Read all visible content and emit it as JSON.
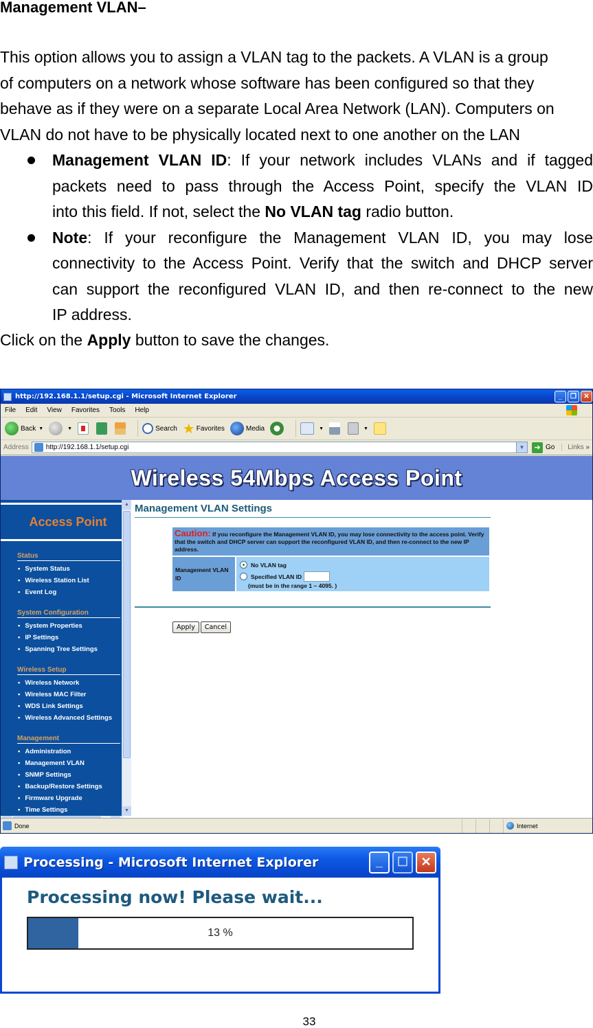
{
  "doc": {
    "heading": "Management VLAN–",
    "intro_lines": [
      "This option allows you to assign a VLAN tag to the packets. A VLAN is a group",
      "of computers on a network whose software has been configured so that they",
      "behave as if they were on a separate Local Area Network (LAN). Computers on",
      "VLAN do not have to be physically located next to one another on the LAN"
    ],
    "bullets": [
      {
        "term": "Management VLAN ID",
        "lines": [
          ": If your network includes VLANs and if tagged",
          "packets need to pass through the Access Point, specify the VLAN ID",
          "into this field. If not, select the "
        ],
        "bold_inline": "No VLAN tag",
        "tail": " radio button."
      },
      {
        "term": "Note",
        "lines": [
          ": If your reconfigure the Management VLAN ID, you may lose",
          "connectivity to the Access Point. Verify that the switch and DHCP server",
          "can support the reconfigured VLAN ID, and then re-connect to the new",
          "IP address."
        ]
      }
    ],
    "click_prefix": "Click on the ",
    "click_bold": "Apply",
    "click_suffix": " button to save the changes.",
    "page_number": "33"
  },
  "ie": {
    "title": "http://192.168.1.1/setup.cgi - Microsoft Internet Explorer",
    "menu": [
      "File",
      "Edit",
      "View",
      "Favorites",
      "Tools",
      "Help"
    ],
    "toolbar": {
      "back": "Back",
      "search": "Search",
      "favorites": "Favorites",
      "media": "Media"
    },
    "address_label": "Address",
    "address_value": "http://192.168.1.1/setup.cgi",
    "go_label": "Go",
    "links_label": "Links",
    "status_text": "Done",
    "zone_text": "Internet"
  },
  "page": {
    "banner": "Wireless 54Mbps Access Point",
    "sidebar_title": "Access Point",
    "groups": [
      {
        "title": "Status",
        "items": [
          "System Status",
          "Wireless Station List",
          "Event Log"
        ]
      },
      {
        "title": "System Configuration",
        "items": [
          "System Properties",
          "IP Settings",
          "Spanning Tree Settings"
        ]
      },
      {
        "title": "Wireless Setup",
        "items": [
          "Wireless Network",
          "Wireless MAC Filter",
          "WDS Link Settings",
          "Wireless Advanced Settings"
        ]
      },
      {
        "title": "Management",
        "items": [
          "Administration",
          "Management VLAN",
          "SNMP Settings",
          "Backup/Restore Settings",
          "Firmware Upgrade",
          "Time Settings"
        ]
      }
    ],
    "section_title": "Management VLAN Settings",
    "caution_word": "Caution:",
    "caution_text": " If you reconfigure the Management VLAN ID, you may lose connectivity to the access point. Verify that the switch and DHCP server can support the reconfigured VLAN ID, and then re-connect to the new IP address.",
    "field_label": "Management VLAN ID",
    "option_no_tag": "No VLAN tag",
    "option_specified": "Specified VLAN ID",
    "selected_option": "No VLAN tag",
    "vlan_id_value": "",
    "range_note": "(must be in the range 1 ~ 4095. )",
    "apply_label": "Apply",
    "cancel_label": "Cancel"
  },
  "dialog": {
    "title": "Processing - Microsoft Internet Explorer",
    "heading": "Processing now! Please wait...",
    "progress_percent": 13,
    "progress_text": "13 %"
  },
  "colors": {
    "banner": "#6483d6",
    "sidebar": "#0b4f9e",
    "sidebar_accent": "#e67f33",
    "caution": "#e01c1c",
    "progress_fill": "#2f64a0"
  }
}
